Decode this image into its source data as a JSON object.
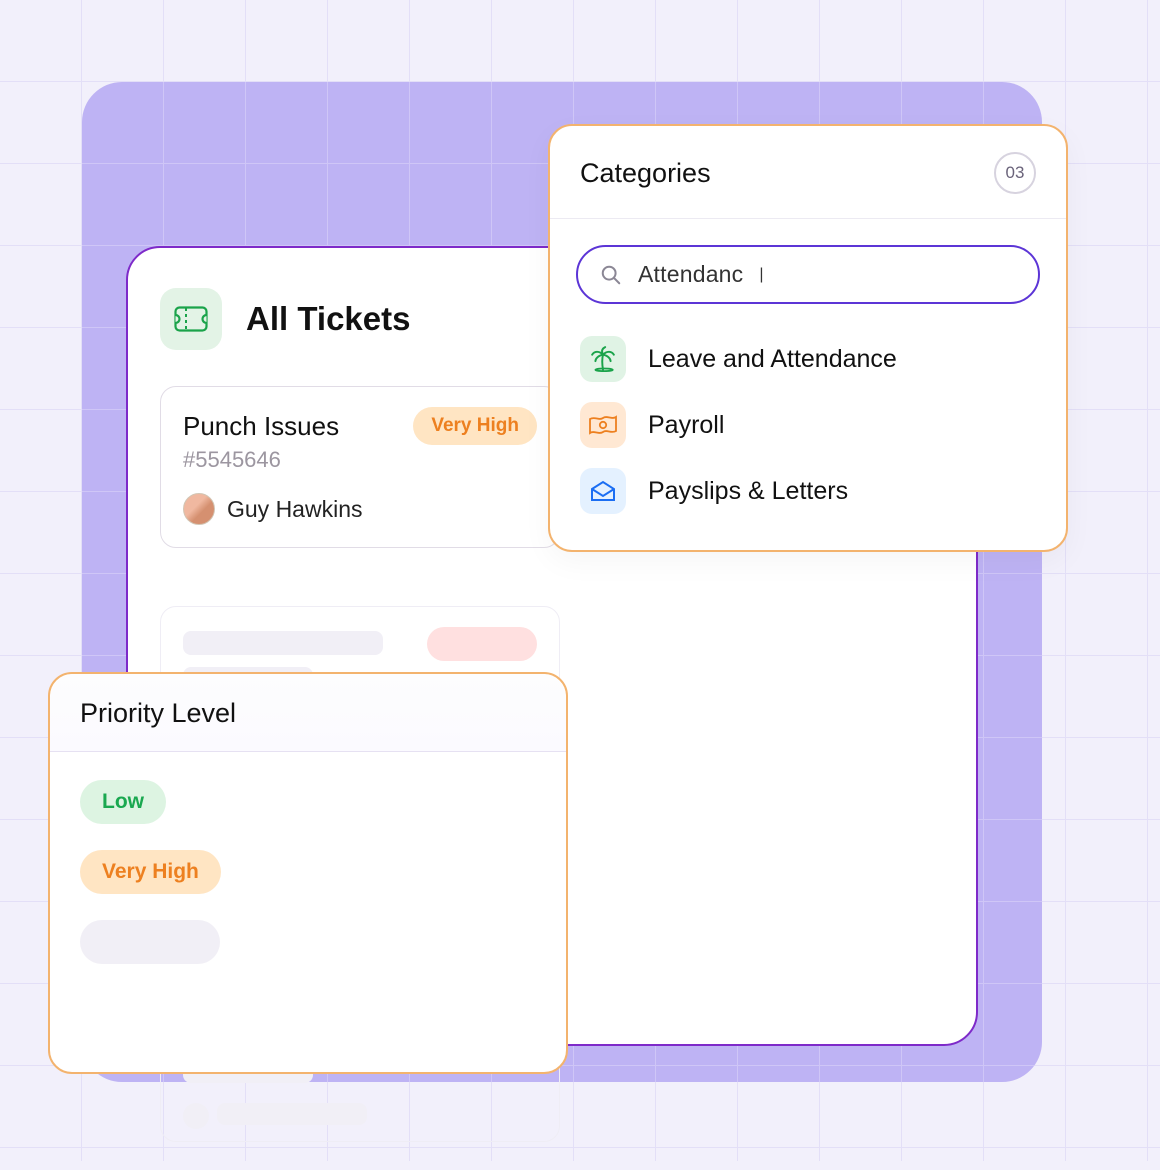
{
  "tickets": {
    "title": "All Tickets",
    "card": {
      "name": "Punch Issues",
      "id": "#5545646",
      "priority": "Very High",
      "assignee": "Guy Hawkins"
    }
  },
  "categories": {
    "title": "Categories",
    "count": "03",
    "search_value": "Attendanc",
    "items": [
      {
        "label": "Leave and Attendance",
        "icon": "palm-tree-icon",
        "color": "green"
      },
      {
        "label": "Payroll",
        "icon": "money-icon",
        "color": "orange"
      },
      {
        "label": "Payslips & Letters",
        "icon": "envelope-icon",
        "color": "blue"
      }
    ]
  },
  "priority": {
    "title": "Priority Level",
    "levels": [
      {
        "label": "Low",
        "class": "low"
      },
      {
        "label": "Very High",
        "class": "vh"
      }
    ]
  }
}
